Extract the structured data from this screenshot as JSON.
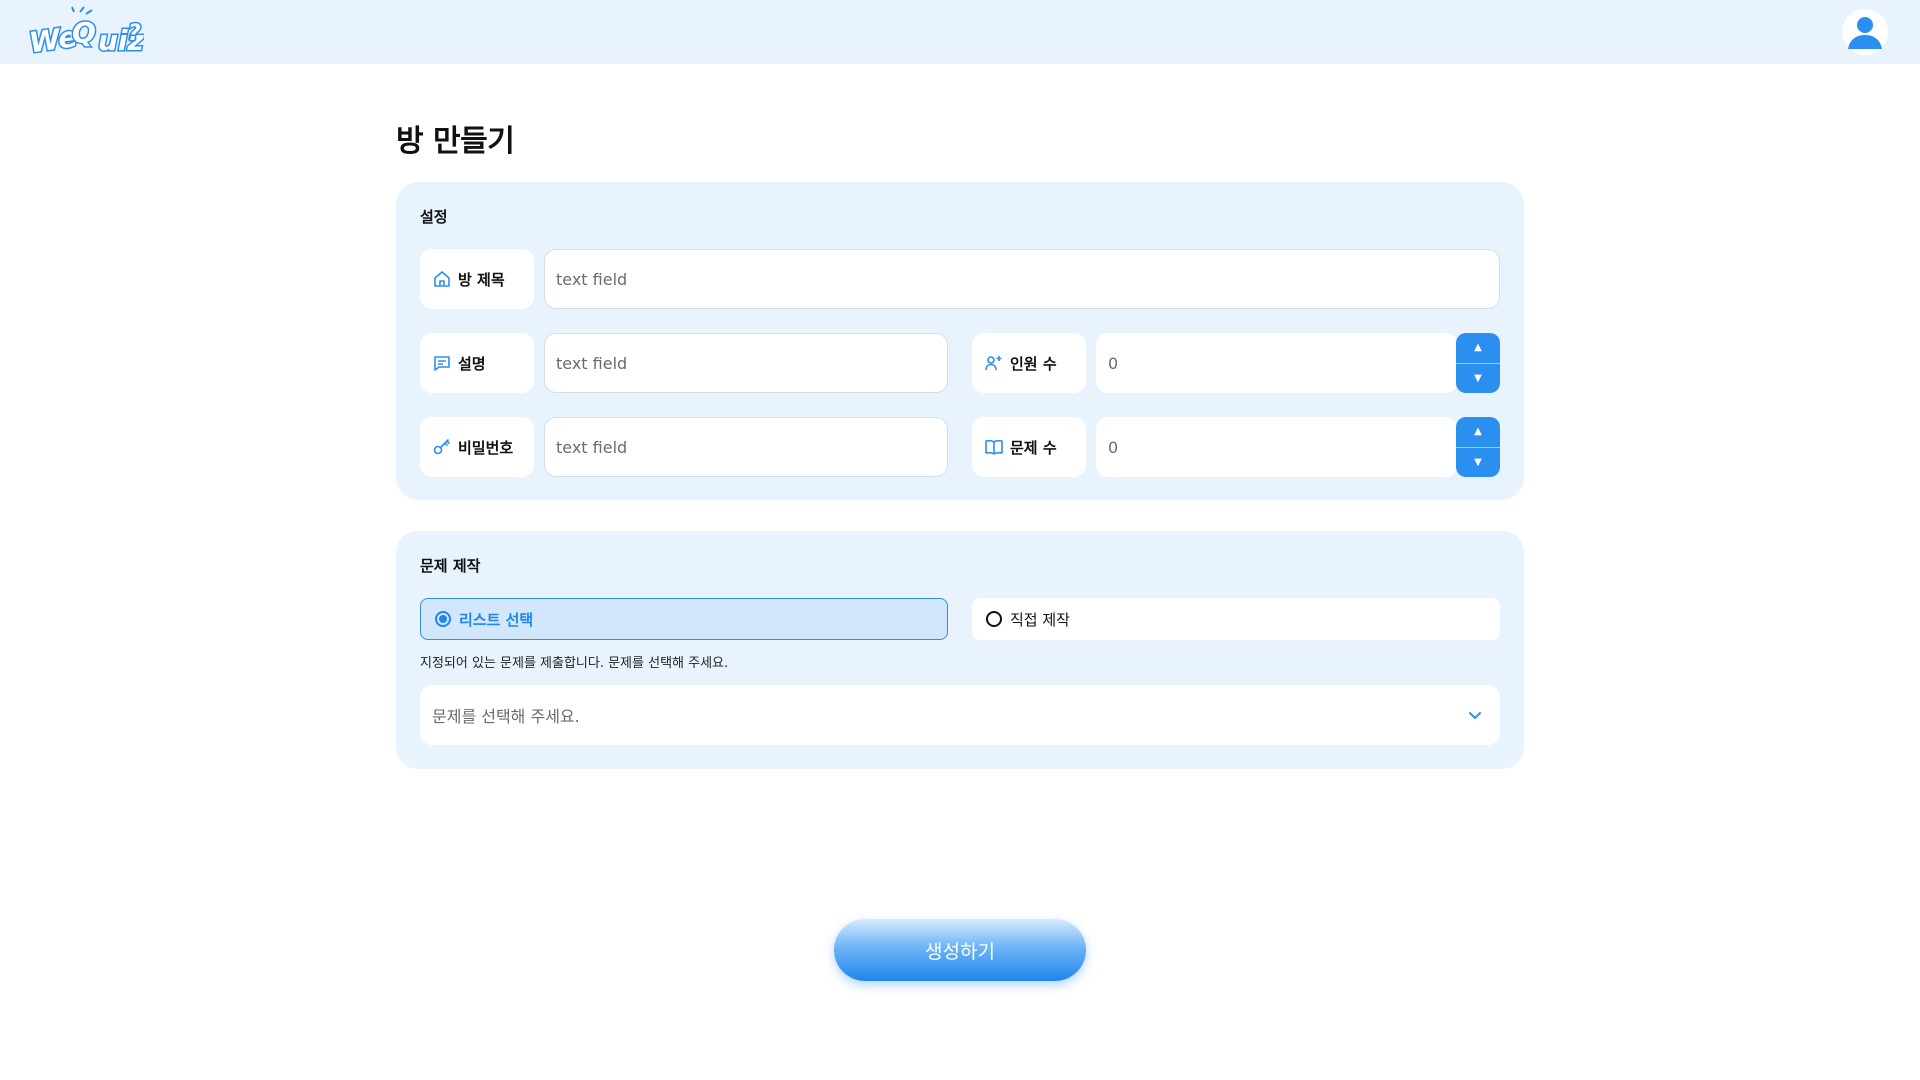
{
  "header": {
    "logo_alt": "WeQuiz logo",
    "avatar_icon": "user-avatar-icon"
  },
  "page": {
    "title": "방 만들기"
  },
  "settings": {
    "heading": "설정",
    "room_title": {
      "label": "방 제목",
      "icon": "home-icon",
      "placeholder": "text field"
    },
    "description": {
      "label": "설명",
      "icon": "chat-icon",
      "placeholder": "text field"
    },
    "password": {
      "label": "비밀번호",
      "icon": "key-icon",
      "placeholder": "text field"
    },
    "participants": {
      "label": "인원 수",
      "icon": "add-user-icon",
      "value": "0"
    },
    "question_count": {
      "label": "문제 수",
      "icon": "book-icon",
      "value": "0"
    }
  },
  "quiz": {
    "heading": "문제 제작",
    "option_list": "리스트 선택",
    "option_custom": "직접 제작",
    "selected_option": "리스트 선택",
    "hint": "지정되어 있는 문제를 제출합니다. 문제를 선택해 주세요.",
    "select_placeholder": "문제를 선택해 주세요."
  },
  "actions": {
    "create": "생성하기"
  },
  "colors": {
    "accent": "#1f86ec",
    "panel_bg": "#e8f3fe",
    "header_bg": "#e8f3fe"
  }
}
